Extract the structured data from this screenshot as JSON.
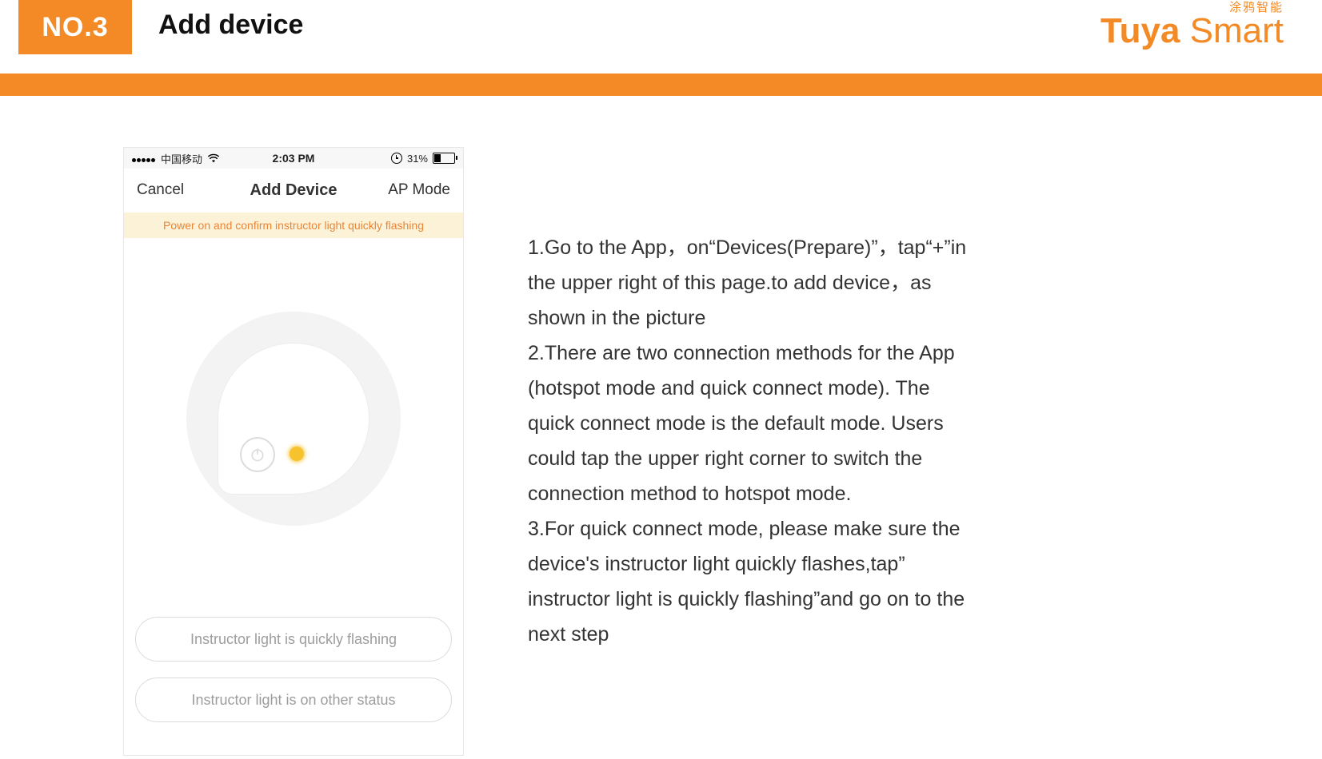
{
  "header": {
    "badge": "NO.3",
    "title": "Add device",
    "brand_cn": "涂鸦智能",
    "brand_bold": "Tuya",
    "brand_light": " Smart"
  },
  "instructions": {
    "text": "1.Go to the App，on“Devices(Prepare)”，tap“+”in the upper right of this page.to add device，as shown in the picture\n2.There are two connection methods for the App (hotspot mode and quick connect mode). The quick connect mode is the default mode. Users could tap the upper right corner to switch the connection method to hotspot mode.\n3.For quick connect mode, please make sure the device's instructor light quickly flashes,tap” instructor light is quickly flashing”and go on to the next step"
  },
  "phone": {
    "statusbar": {
      "carrier": "中国移动",
      "time": "2:03 PM",
      "battery_pct": "31%"
    },
    "navbar": {
      "left": "Cancel",
      "title": "Add Device",
      "right": "AP Mode"
    },
    "banner": "Power on and confirm instructor light quickly flashing",
    "buttons": {
      "primary": "Instructor light is quickly flashing",
      "secondary": "Instructor light is on other status"
    }
  }
}
